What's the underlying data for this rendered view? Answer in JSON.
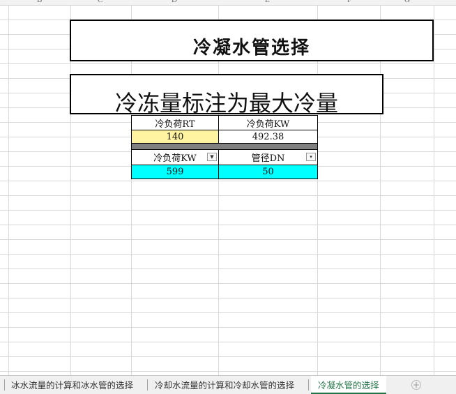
{
  "columns": [
    "B",
    "C",
    "D",
    "E",
    "F",
    "G"
  ],
  "title_main": "冷凝水管选择",
  "title_sub": "冷冻量标注为最大冷量",
  "table1": {
    "headers": [
      "冷负荷RT",
      "冷负荷KW"
    ],
    "values": [
      "140",
      "492.38"
    ]
  },
  "table2": {
    "headers": [
      "冷负荷KW",
      "管径DN"
    ],
    "values": [
      "599",
      "50"
    ],
    "filter_icons": [
      "filter-active-icon",
      "dropdown-arrow-icon"
    ]
  },
  "sheet_tabs": [
    {
      "label": "冰水流量的计算和冰水管的选择",
      "active": false
    },
    {
      "label": "冷却水流量的计算和冷却水管的选择",
      "active": false
    },
    {
      "label": "冷凝水管的选择",
      "active": true
    }
  ],
  "add_sheet_icon": "plus-circle-icon",
  "colors": {
    "input_yellow": "#fff2a0",
    "result_cyan": "#00ffff",
    "separator_gray": "#808080",
    "active_tab": "#217346"
  }
}
